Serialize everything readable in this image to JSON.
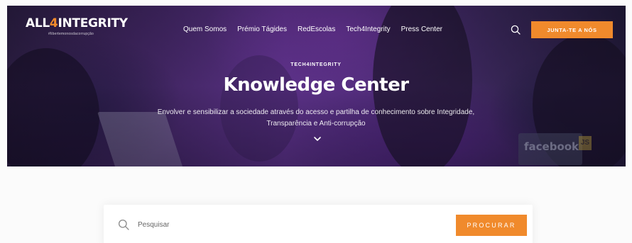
{
  "header": {
    "logo_text_prefix": "ALL",
    "logo_text_accent": "4",
    "logo_text_suffix": "INTEGRITY",
    "logo_tagline": "#libertemonosdacorrupção",
    "nav_items": [
      {
        "label": "Quem Somos"
      },
      {
        "label": "Prémio Tágides"
      },
      {
        "label": "RedEscolas"
      },
      {
        "label": "Tech4Integrity"
      },
      {
        "label": "Press Center"
      }
    ],
    "search_icon": "search-icon",
    "cta_label": "JUNTA-TE A NÓS"
  },
  "hero": {
    "eyebrow": "TECH4INTEGRITY",
    "title": "Knowledge Center",
    "subtitle_line1": "Envolver e sensibilizar a sociedade através do acesso e partilha de conhecimento sobre Integridade,",
    "subtitle_line2": "Transparência e Anti-corrupção",
    "scroll_icon": "chevron-down-icon",
    "laptop_text": "facebook",
    "sticker_text": "JS"
  },
  "search": {
    "placeholder": "Pesquisar",
    "button_label": "PROCURAR",
    "icon": "search-icon"
  },
  "colors": {
    "accent": "#f08a2c",
    "hero_purple": "#6a3a9a",
    "text_white": "#ffffff"
  }
}
